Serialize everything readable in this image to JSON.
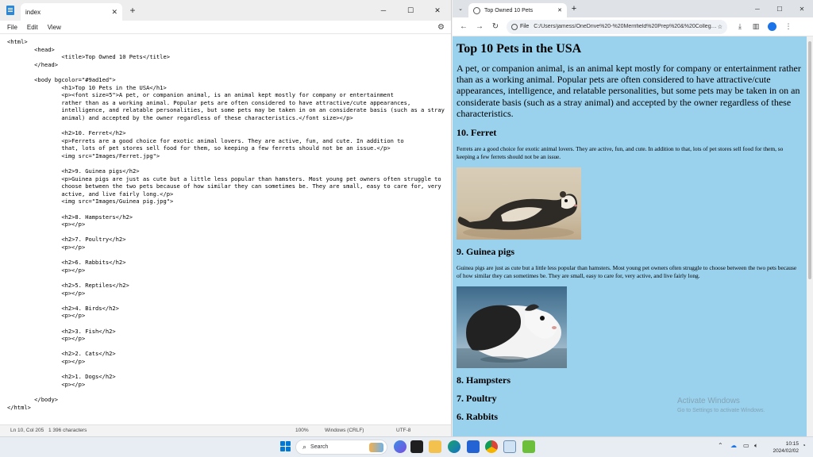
{
  "notepad": {
    "tab_title": "index",
    "menus": [
      "File",
      "Edit",
      "View"
    ],
    "code_lines": [
      "<html>",
      "        <head>",
      "                <title>Top Owned 10 Pets</title>",
      "        </head>",
      "",
      "        <body bgcolor=\"#9ad1ed\">",
      "                <h1>Top 10 Pets in the USA</h1>",
      "                <p><font size=5\">A pet, or companion animal, is an animal kept mostly for company or entertainment",
      "                rather than as a working animal. Popular pets are often considered to have attractive/cute appearances,",
      "                intelligence, and relatable personalities, but some pets may be taken in on an considerate basis (such as a stray",
      "                animal) and accepted by the owner regardless of these characteristics.</font size></p>",
      "",
      "                <h2>10. Ferret</h2>",
      "                <p>Ferrets are a good choice for exotic animal lovers. They are active, fun, and cute. In addition to",
      "                that, lots of pet stores sell food for them, so keeping a few ferrets should not be an issue.</p>",
      "                <img src=\"Images/Ferret.jpg\">",
      "",
      "                <h2>9. Guinea pigs</h2>",
      "                <p>Guinea pigs are just as cute but a little less popular than hamsters. Most young pet owners often struggle to",
      "                choose between the two pets because of how similar they can sometimes be. They are small, easy to care for, very",
      "                active, and live fairly long.</p>",
      "                <img src=\"Images/Guinea pig.jpg\">",
      "",
      "                <h2>8. Hampsters</h2>",
      "                <p></p>",
      "",
      "                <h2>7. Poultry</h2>",
      "                <p></p>",
      "",
      "                <h2>6. Rabbits</h2>",
      "                <p></p>",
      "",
      "                <h2>5. Reptiles</h2>",
      "                <p></p>",
      "",
      "                <h2>4. Birds</h2>",
      "                <p></p>",
      "",
      "                <h2>3. Fish</h2>",
      "                <p></p>",
      "",
      "                <h2>2. Cats</h2>",
      "                <p></p>",
      "",
      "                <h2>1. Dogs</h2>",
      "                <p></p>",
      "",
      "        </body>",
      "</html>"
    ],
    "status": {
      "position": "Ln 10, Col 205",
      "chars": "1 396 characters",
      "zoom": "100%",
      "line_endings": "Windows (CRLF)",
      "encoding": "UTF-8"
    }
  },
  "browser": {
    "tab_title": "Top Owned 10 Pets",
    "scheme_label": "File",
    "url": "C:/Users/jamess/OneDrive%20-%20Merrifield%20Prep%20&%20College/i...",
    "page": {
      "bgcolor": "#9ad1ed",
      "h1": "Top 10 Pets in the USA",
      "intro": "A pet, or companion animal, is an animal kept mostly for company or entertainment rather than as a working animal. Popular pets are often considered to have attractive/cute appearances, intelligence, and relatable personalities, but some pets may be taken in on an considerate basis (such as a stray animal) and accepted by the owner regardless of these characteristics.",
      "ferret_heading": "10. Ferret",
      "ferret_text": "Ferrets are a good choice for exotic animal lovers. They are active, fun, and cute. In addition to that, lots of pet stores sell food for them, so keeping a few ferrets should not be an issue.",
      "guinea_heading": "9. Guinea pigs",
      "guinea_text": "Guinea pigs are just as cute but a little less popular than hamsters. Most young pet owners often struggle to choose between the two pets because of how similar they can sometimes be. They are small, easy to care for, very active, and live fairly long.",
      "h8": "8. Hampsters",
      "h7": "7. Poultry",
      "h6": "6. Rabbits"
    },
    "watermark_title": "Activate Windows",
    "watermark_sub": "Go to Settings to activate Windows."
  },
  "taskbar": {
    "search_placeholder": "Search",
    "time": "10:15",
    "date": "2024/02/02"
  },
  "colors": {
    "page_bg": "#9ad1ed",
    "accent": "#0078d4"
  }
}
